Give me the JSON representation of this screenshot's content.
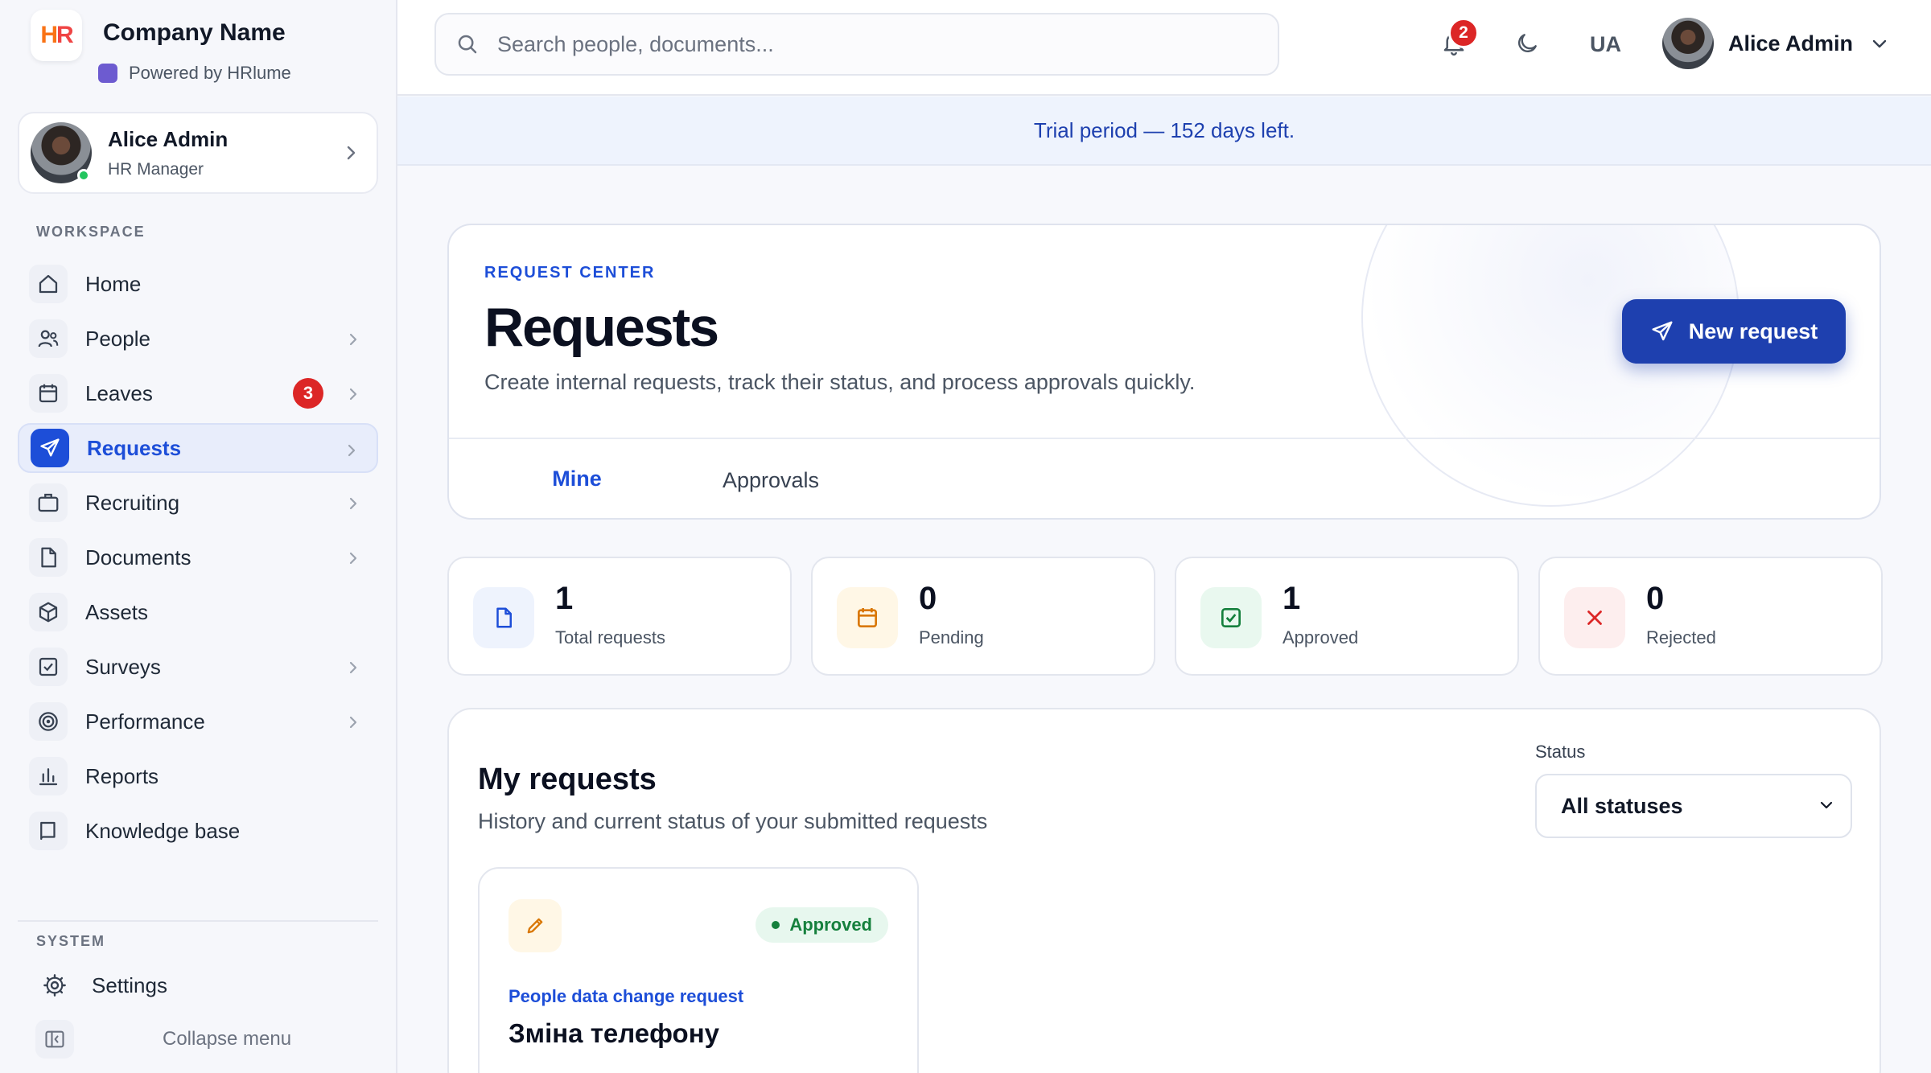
{
  "brand": {
    "name": "Company Name",
    "powered_by": "Powered by HRlume",
    "logo_h": "H",
    "logo_r": "R"
  },
  "user": {
    "name": "Alice Admin",
    "role": "HR Manager"
  },
  "sidebar": {
    "workspace_label": "WORKSPACE",
    "items": [
      {
        "label": "Home",
        "icon": "home-icon",
        "chevron": false
      },
      {
        "label": "People",
        "icon": "people-icon",
        "chevron": true
      },
      {
        "label": "Leaves",
        "icon": "calendar-icon",
        "chevron": true,
        "badge": "3"
      },
      {
        "label": "Requests",
        "icon": "send-icon",
        "chevron": true,
        "active": true
      },
      {
        "label": "Recruiting",
        "icon": "briefcase-icon",
        "chevron": true
      },
      {
        "label": "Documents",
        "icon": "document-icon",
        "chevron": true
      },
      {
        "label": "Assets",
        "icon": "cube-icon",
        "chevron": false
      },
      {
        "label": "Surveys",
        "icon": "checkbox-icon",
        "chevron": true
      },
      {
        "label": "Performance",
        "icon": "target-icon",
        "chevron": true
      },
      {
        "label": "Reports",
        "icon": "bar-chart-icon",
        "chevron": false
      },
      {
        "label": "Knowledge base",
        "icon": "book-icon",
        "chevron": false
      }
    ],
    "system_label": "SYSTEM",
    "settings_label": "Settings",
    "collapse_label": "Collapse menu"
  },
  "topbar": {
    "search_placeholder": "Search people, documents...",
    "notifications_count": "2",
    "language": "UA",
    "user_name": "Alice Admin"
  },
  "trial_banner": "Trial period — 152 days left.",
  "hero": {
    "eyebrow": "REQUEST CENTER",
    "title": "Requests",
    "subtitle": "Create internal requests, track their status, and process approvals quickly.",
    "new_request_label": "New request",
    "tabs": [
      {
        "label": "Mine",
        "active": true
      },
      {
        "label": "Approvals",
        "active": false
      }
    ]
  },
  "stats": [
    {
      "value": "1",
      "label": "Total requests",
      "icon": "document-icon",
      "bg": "#eef3fd",
      "color": "#1d4ed8"
    },
    {
      "value": "0",
      "label": "Pending",
      "icon": "calendar-icon",
      "bg": "#fff7e6",
      "color": "#d97706"
    },
    {
      "value": "1",
      "label": "Approved",
      "icon": "check-square-icon",
      "bg": "#e9f8ef",
      "color": "#15803d"
    },
    {
      "value": "0",
      "label": "Rejected",
      "icon": "x-icon",
      "bg": "#fdeeee",
      "color": "#dc2626"
    }
  ],
  "my_requests": {
    "title": "My requests",
    "subtitle": "History and current status of your submitted requests",
    "status_label": "Status",
    "status_value": "All statuses",
    "cards": [
      {
        "category": "People data change request",
        "title": "Зміна телефону",
        "status": "Approved",
        "icon": "pencil-icon"
      }
    ]
  },
  "colors": {
    "accent": "#1d4ed8",
    "danger": "#dc2626",
    "success": "#15803d"
  }
}
